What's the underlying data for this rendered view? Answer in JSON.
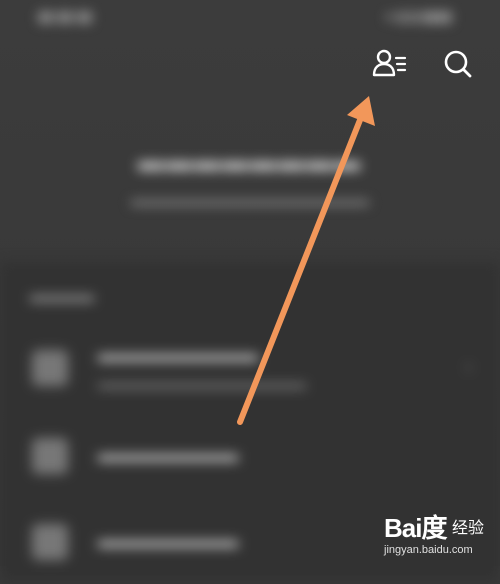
{
  "header": {
    "user_list_icon": "user-list-icon",
    "search_icon": "search-icon"
  },
  "watermark": {
    "logo": "Bai度",
    "label": "经验",
    "url": "jingyan.baidu.com"
  },
  "colors": {
    "background": "#3a3a3a",
    "arrow": "#f2975a",
    "icon": "#ffffff"
  }
}
